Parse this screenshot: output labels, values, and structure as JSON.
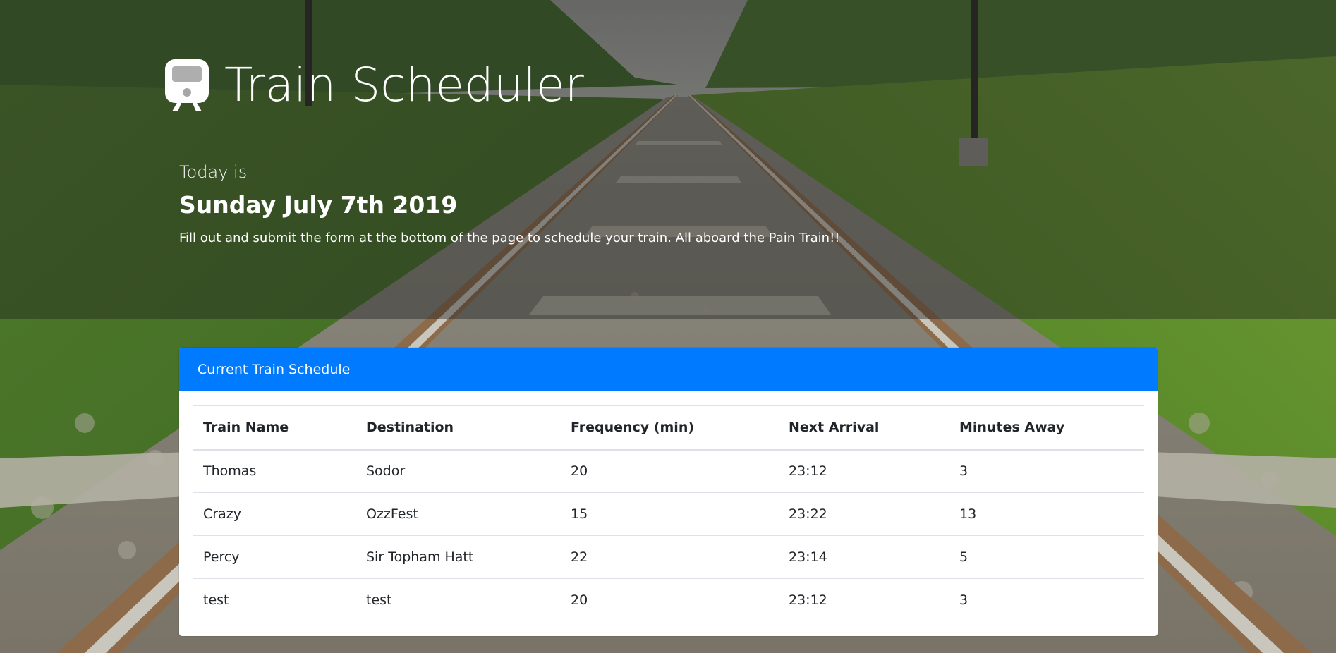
{
  "header": {
    "title": "Train Scheduler",
    "icon": "train-icon"
  },
  "today": {
    "label": "Today is",
    "date": "Sunday July 7th 2019"
  },
  "lead": "Fill out and submit the form at the bottom of the page to schedule your train. All aboard the Pain Train!!",
  "schedule": {
    "title": "Current Train Schedule",
    "columns": [
      "Train Name",
      "Destination",
      "Frequency (min)",
      "Next Arrival",
      "Minutes Away"
    ],
    "rows": [
      [
        "Thomas",
        "Sodor",
        "20",
        "23:12",
        "3"
      ],
      [
        "Crazy",
        "OzzFest",
        "15",
        "23:22",
        "13"
      ],
      [
        "Percy",
        "Sir Topham Hatt",
        "22",
        "23:14",
        "5"
      ],
      [
        "test",
        "test",
        "20",
        "23:12",
        "3"
      ]
    ]
  },
  "colors": {
    "header_blue": "#007bff",
    "text_dark": "#212529"
  }
}
